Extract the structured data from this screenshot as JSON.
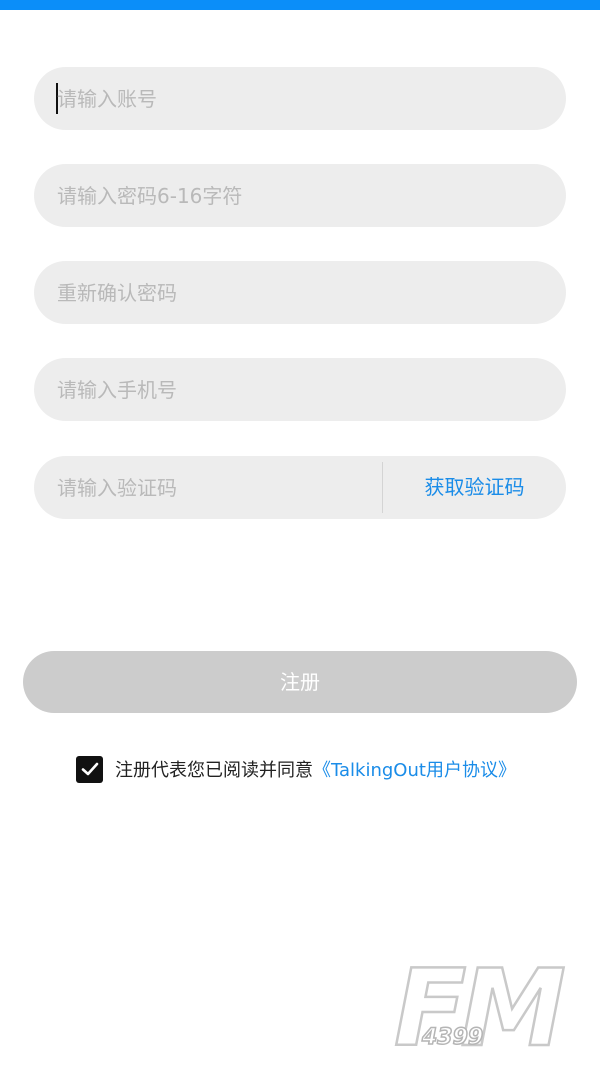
{
  "form": {
    "account_placeholder": "请输入账号",
    "password_placeholder": "请输入密码6-16字符",
    "confirm_placeholder": "重新确认密码",
    "phone_placeholder": "请输入手机号",
    "code_placeholder": "请输入验证码",
    "get_code_label": "获取验证码"
  },
  "register": {
    "label": "注册"
  },
  "agreement": {
    "checked": true,
    "text": "注册代表您已阅读并同意",
    "link": "《TalkingOut用户协议》"
  },
  "watermark": {
    "logo_text": "FM",
    "sub_text": "4399"
  },
  "colors": {
    "accent": "#0b8ef9",
    "link": "#1a8ce8",
    "field_bg": "#ededed",
    "button_disabled": "#cccccc"
  },
  "icons": [
    "checkmark-icon",
    "fm-4399-logo"
  ]
}
